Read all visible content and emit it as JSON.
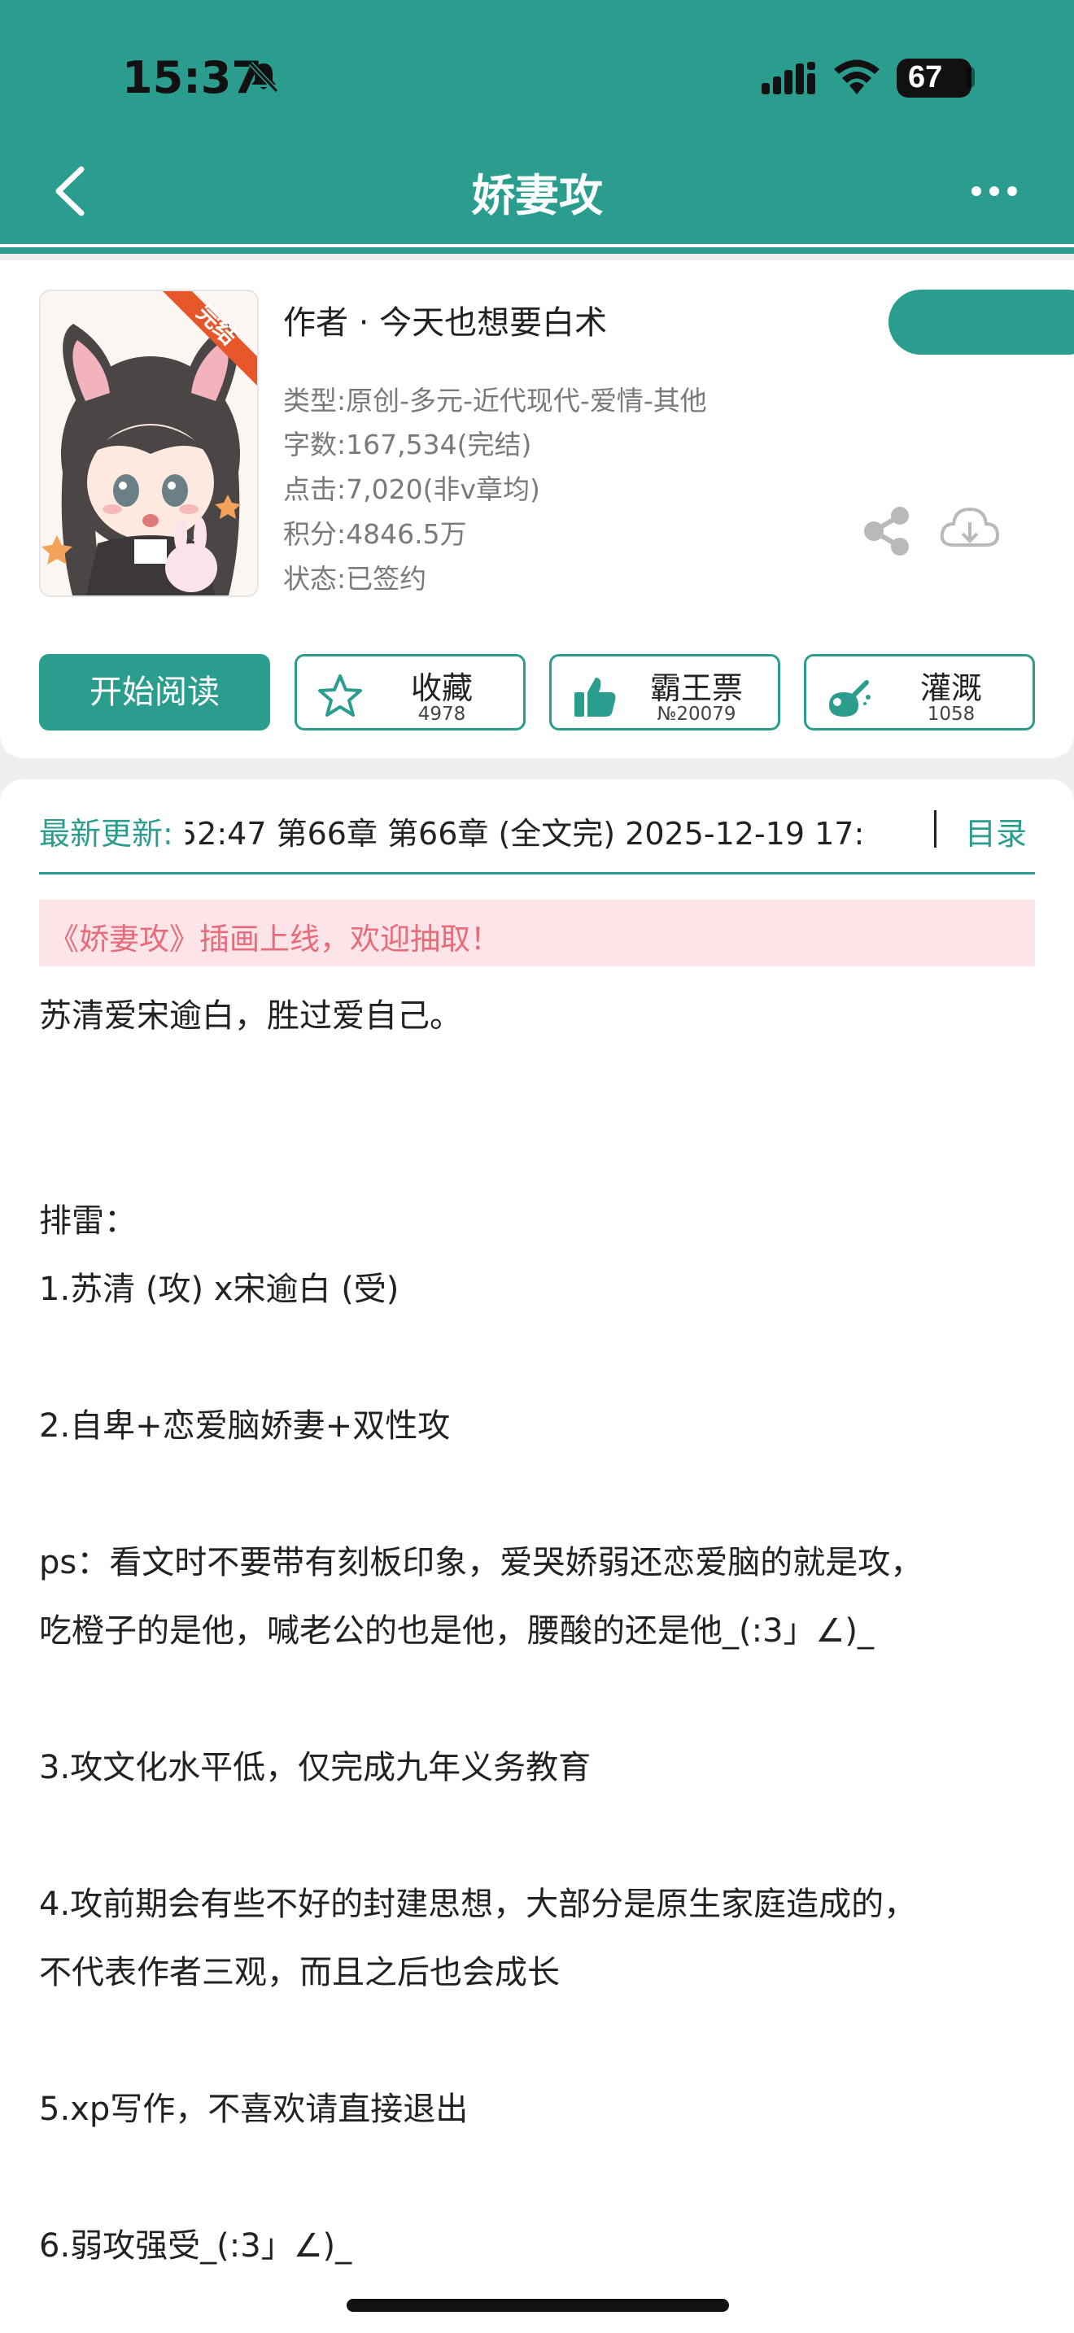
{
  "status_bar": {
    "time": "15:37",
    "battery": "67",
    "battery_level": 0.67
  },
  "nav": {
    "title": "娇妻攻"
  },
  "book": {
    "author": "作者 · 今天也想要白术",
    "badge": "完结",
    "meta": [
      "类型:原创-多元-近代现代-爱情-其他",
      "字数:167,534(完结)",
      "点击:7,020(非v章均)",
      "积分:4846.5万",
      "状态:已签约"
    ]
  },
  "actions": {
    "read": "开始阅读",
    "favorite": {
      "label": "收藏",
      "count": "4978"
    },
    "vote": {
      "label": "霸王票",
      "count": "№20079"
    },
    "water": {
      "label": "灌溉",
      "count": "1058"
    }
  },
  "update": {
    "label": "最新更新:",
    "text": "52:47   第66章 第66章 (全文完) 2025-12-19 17:",
    "toc": "目录"
  },
  "banner": "《娇妻攻》插画上线，欢迎抽取！",
  "content": [
    "苏清爱宋逾白，胜过爱自己。",
    "排雷：",
    "1.苏清 (攻) x宋逾白 (受)",
    "2.自卑+恋爱脑娇妻+双性攻",
    "ps：看文时不要带有刻板印象，爱哭娇弱还恋爱脑的就是攻，",
    "吃橙子的是他，喊老公的也是他，腰酸的还是他_(:3」∠)_",
    "3.攻文化水平低，仅完成九年义务教育",
    "4.攻前期会有些不好的封建思想，大部分是原生家庭造成的，",
    "不代表作者三观，而且之后也会成长",
    "5.xp写作，不喜欢请直接退出",
    "6.弱攻强受_(:3」∠)_"
  ],
  "colors": {
    "accent": "#2a9d8f",
    "banner_bg": "#fde4e8",
    "banner_text": "#e86b7a"
  }
}
